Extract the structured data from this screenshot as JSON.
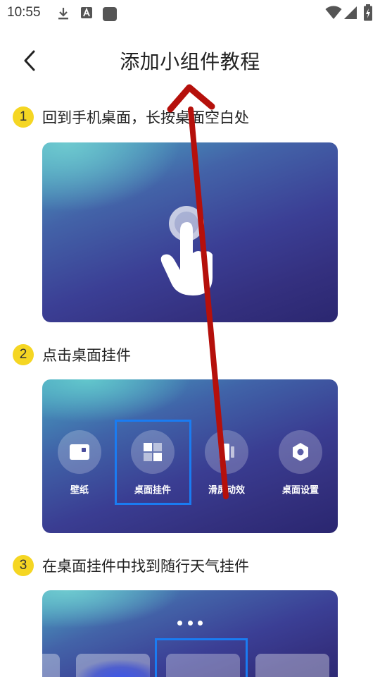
{
  "status_bar": {
    "time": "10:55",
    "icons": [
      "download-icon",
      "a-box-icon",
      "square-icon",
      "wifi-icon",
      "signal-icon",
      "battery-icon"
    ]
  },
  "header": {
    "back_icon": "chevron-left-icon",
    "title": "添加小组件教程"
  },
  "steps": [
    {
      "number": "1",
      "text": "回到手机桌面，长按桌面空白处"
    },
    {
      "number": "2",
      "text": "点击桌面挂件"
    },
    {
      "number": "3",
      "text": "在桌面挂件中找到随行天气挂件"
    }
  ],
  "menu": [
    {
      "label": "壁纸",
      "icon": "wallpaper-icon"
    },
    {
      "label": "桌面挂件",
      "icon": "widget-icon",
      "highlighted": true
    },
    {
      "label": "滑屏动效",
      "icon": "swipe-effect-icon"
    },
    {
      "label": "桌面设置",
      "icon": "settings-hexagon-icon"
    }
  ],
  "colors": {
    "step_badge": "#f5d623",
    "highlight": "#1a7cf2",
    "arrow": "#b5100b"
  }
}
